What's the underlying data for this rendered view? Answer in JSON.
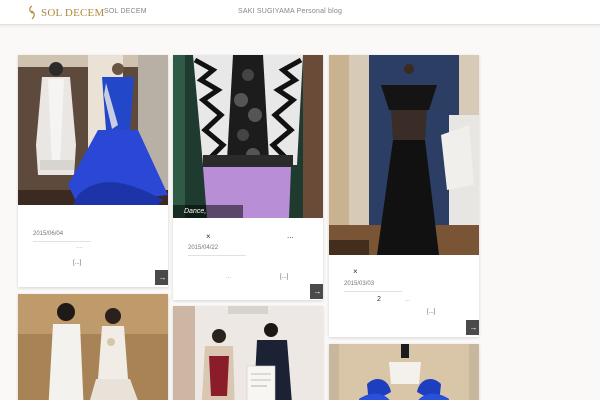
{
  "header": {
    "logo_text": "SOL DECEM",
    "nav": [
      {
        "label": "SOL DECEM"
      },
      {
        "label": "SAKI SUGIYAMA Personal blog"
      }
    ]
  },
  "posts": [
    {
      "date": "2015/06/04",
      "dots": "....",
      "excerpt": "[...]",
      "more": "→"
    },
    {
      "caption": "Dance,",
      "close": "×",
      "options": "...",
      "date": "2015/04/22",
      "dots": "...",
      "excerpt": "[...]",
      "more": "→"
    },
    {
      "close": "×",
      "date": "2015/03/03",
      "count": "2",
      "dots": "...",
      "excerpt": "[...]",
      "more": "→"
    },
    {},
    {},
    {}
  ],
  "colors": {
    "accent": "#b08a3a",
    "button": "#4a4a4a",
    "background": "#fbf9f7"
  }
}
